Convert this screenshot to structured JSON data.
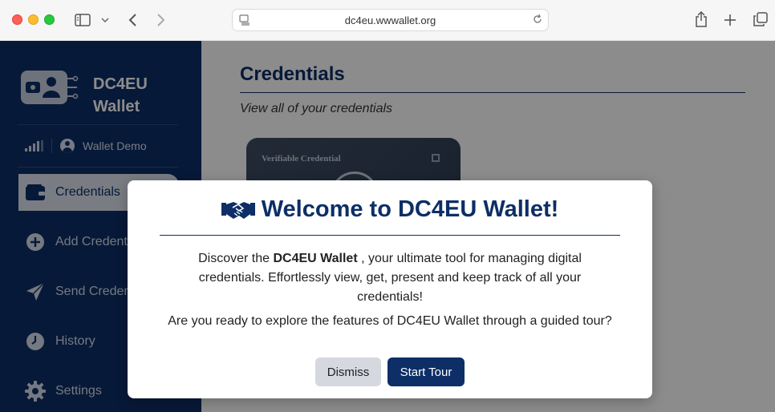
{
  "browser": {
    "url": "dc4eu.wwwallet.org"
  },
  "sidebar": {
    "brand_line1": "DC4EU",
    "brand_line2": "Wallet",
    "user_name": "Wallet Demo",
    "items": [
      {
        "label": "Credentials",
        "icon": "wallet-icon",
        "active": true
      },
      {
        "label": "Add Credentials",
        "icon": "plus-circle-icon",
        "active": false
      },
      {
        "label": "Send Credentials",
        "icon": "paper-plane-icon",
        "active": false
      },
      {
        "label": "History",
        "icon": "clock-icon",
        "active": false
      },
      {
        "label": "Settings",
        "icon": "gear-icon",
        "active": false
      }
    ]
  },
  "main": {
    "title": "Credentials",
    "subtitle": "View all of your credentials",
    "card_label": "Verifiable Credential"
  },
  "modal": {
    "title": "Welcome to DC4EU Wallet!",
    "body_prefix": "Discover the ",
    "body_brand": "DC4EU Wallet",
    "body_suffix": " , your ultimate tool for managing digital credentials. Effortlessly view, get, present and keep track of all your credentials!",
    "question": "Are you ready to explore the features of DC4EU Wallet through a guided tour?",
    "dismiss_label": "Dismiss",
    "start_label": "Start Tour"
  },
  "colors": {
    "brand": "#0d2e66",
    "overlay": "rgba(0,0,0,0.45)"
  }
}
